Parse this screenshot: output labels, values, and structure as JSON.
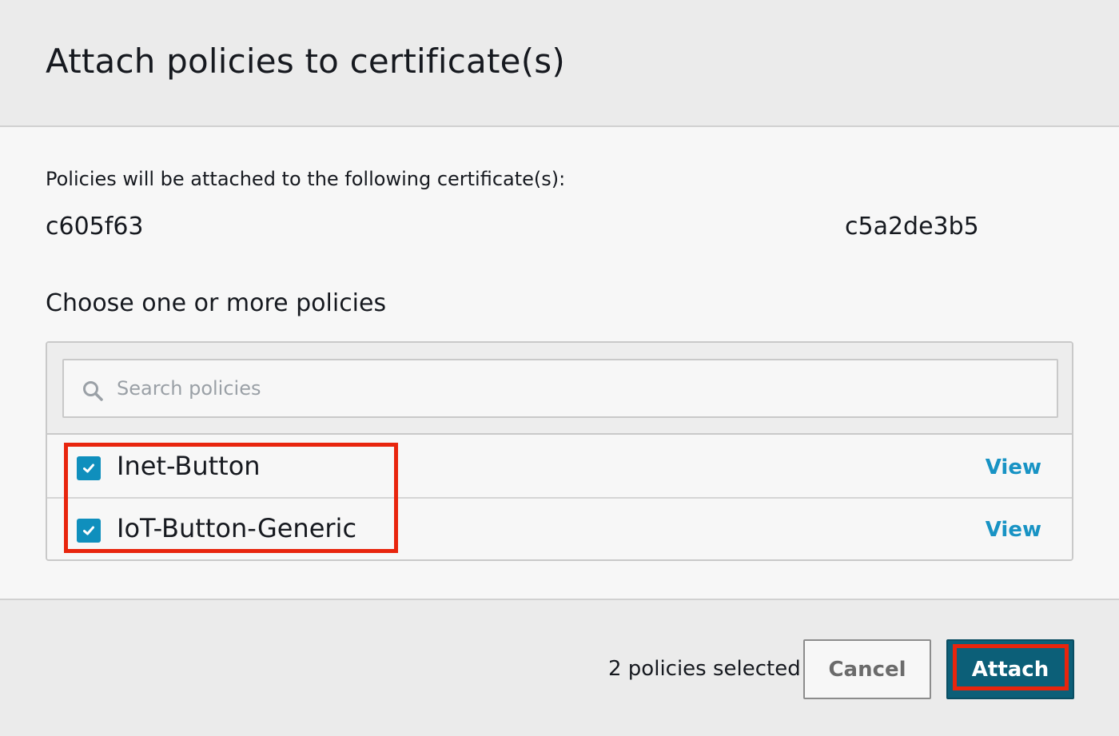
{
  "dialog": {
    "title": "Attach policies to certificate(s)"
  },
  "body": {
    "intro": "Policies will be attached to the following certificate(s):",
    "certificate": {
      "id_start": "c605f63",
      "id_end": "c5a2de3b5"
    },
    "choose_heading": "Choose one or more policies"
  },
  "search": {
    "icon": "search-icon",
    "placeholder": "Search policies"
  },
  "policies": [
    {
      "name": "Inet-Button",
      "checked": true,
      "view_label": "View"
    },
    {
      "name": "IoT-Button-Generic",
      "checked": true,
      "view_label": "View"
    }
  ],
  "footer": {
    "selected_count": "2 policies selected",
    "cancel_label": "Cancel",
    "attach_label": "Attach"
  },
  "colors": {
    "primary_button": "#0c5f78",
    "checkbox": "#0f8fbd",
    "link": "#1893c4",
    "highlight": "#e8250d"
  }
}
